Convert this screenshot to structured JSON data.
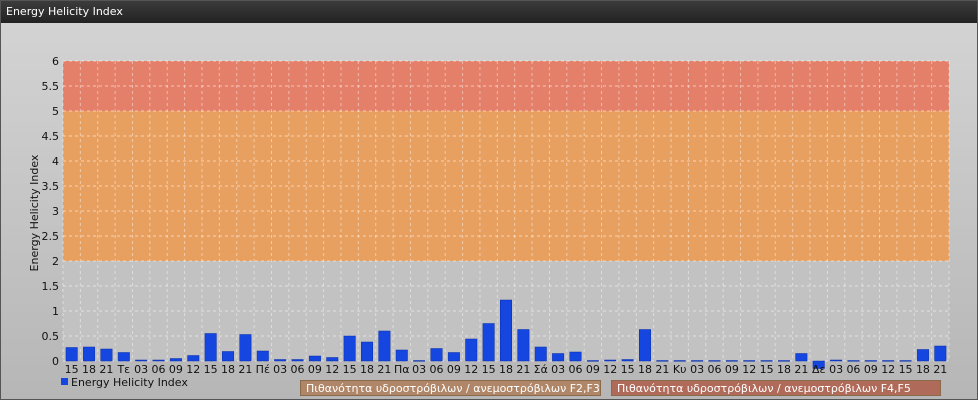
{
  "window": {
    "title": "Energy Helicity Index"
  },
  "chart_data": {
    "type": "bar",
    "ylabel": "Energy Helicity Index",
    "ylim": [
      0,
      6
    ],
    "yticks": [
      "0",
      "0.5",
      "1",
      "1.5",
      "2",
      "2.5",
      "3",
      "3.5",
      "4",
      "4.5",
      "5",
      "5.5",
      "6"
    ],
    "categories": [
      "15",
      "18",
      "21",
      "Τε",
      "03",
      "06",
      "09",
      "12",
      "15",
      "18",
      "21",
      "Πέ",
      "03",
      "06",
      "09",
      "12",
      "15",
      "18",
      "21",
      "Πα",
      "03",
      "06",
      "09",
      "12",
      "15",
      "18",
      "21",
      "Σά",
      "03",
      "06",
      "09",
      "12",
      "15",
      "18",
      "21",
      "Κυ",
      "03",
      "06",
      "09",
      "12",
      "15",
      "18",
      "21",
      "Δε",
      "03",
      "06",
      "09",
      "12",
      "15",
      "18",
      "21"
    ],
    "series": [
      {
        "name": "Energy Helicity Index",
        "color": "#1546e0",
        "values": [
          0.27,
          0.28,
          0.24,
          0.17,
          0.02,
          0.02,
          0.05,
          0.11,
          0.55,
          0.19,
          0.53,
          0.2,
          0.03,
          0.03,
          0.1,
          0.07,
          0.5,
          0.38,
          0.6,
          0.22,
          0.01,
          0.25,
          0.17,
          0.44,
          0.75,
          1.22,
          0.63,
          0.28,
          0.15,
          0.18,
          0.01,
          0.02,
          0.03,
          0.63,
          0.01,
          0.01,
          0.01,
          0.01,
          0.01,
          0.01,
          0.01,
          0.01,
          0.15,
          -0.15,
          0.02,
          0.01,
          0.01,
          0.01,
          0.01,
          0.23,
          0.3
        ]
      }
    ],
    "bands": [
      {
        "from": 2,
        "to": 5,
        "color": "#e8a060",
        "label": "Πιθανότητα υδροστρόβιλων / ανεμοστρόβιλων F2,F3"
      },
      {
        "from": 5,
        "to": 6,
        "color": "#e4806a",
        "label": "Πιθανότητα υδροστρόβιλων / ανεμοστρόβιλων F4,F5"
      }
    ],
    "grid": true,
    "legend": {
      "placement": "bottom-left",
      "label": "Energy Helicity Index"
    }
  }
}
